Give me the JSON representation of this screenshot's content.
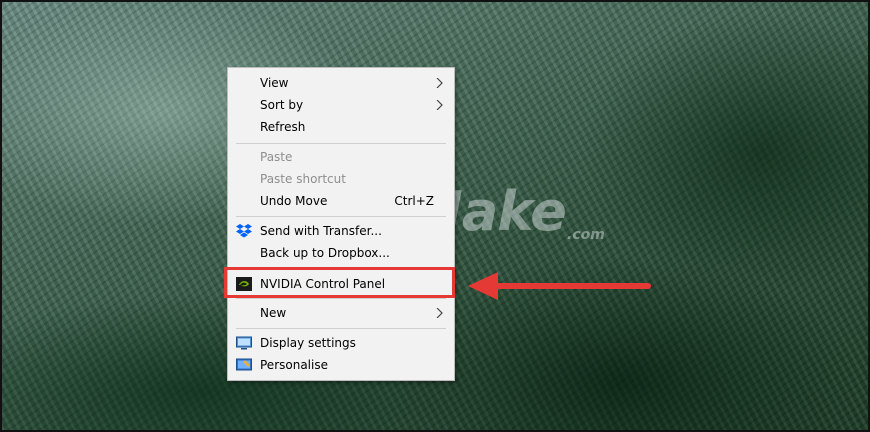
{
  "watermark": {
    "text": "TipsMake",
    "suffix": ".com"
  },
  "context_menu": {
    "view": "View",
    "sort_by": "Sort by",
    "refresh": "Refresh",
    "paste": "Paste",
    "paste_shortcut": "Paste shortcut",
    "undo_move": "Undo Move",
    "undo_shortcut": "Ctrl+Z",
    "send_with_transfer": "Send with Transfer...",
    "backup_dropbox": "Back up to Dropbox...",
    "nvidia": "NVIDIA Control Panel",
    "new": "New",
    "display_settings": "Display settings",
    "personalise": "Personalise"
  },
  "icons": {
    "dropbox": "dropbox-icon",
    "nvidia": "nvidia-icon",
    "display": "display-icon",
    "personalise": "personalise-icon"
  },
  "colors": {
    "highlight": "#e53935",
    "dropbox": "#0061fe",
    "nvidia": "#76b900"
  }
}
